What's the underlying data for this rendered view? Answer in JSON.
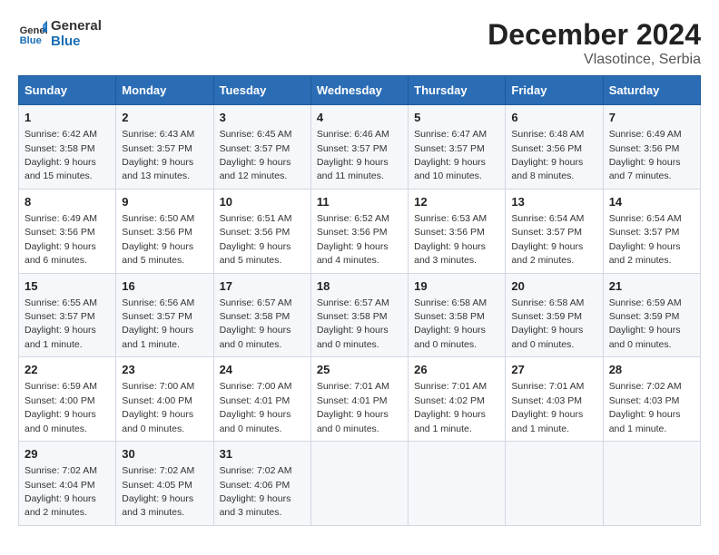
{
  "logo": {
    "text_general": "General",
    "text_blue": "Blue"
  },
  "title": "December 2024",
  "subtitle": "Vlasotince, Serbia",
  "days_of_week": [
    "Sunday",
    "Monday",
    "Tuesday",
    "Wednesday",
    "Thursday",
    "Friday",
    "Saturday"
  ],
  "weeks": [
    [
      {
        "day": "1",
        "sunrise": "6:42 AM",
        "sunset": "3:58 PM",
        "daylight": "9 hours and 15 minutes."
      },
      {
        "day": "2",
        "sunrise": "6:43 AM",
        "sunset": "3:57 PM",
        "daylight": "9 hours and 13 minutes."
      },
      {
        "day": "3",
        "sunrise": "6:45 AM",
        "sunset": "3:57 PM",
        "daylight": "9 hours and 12 minutes."
      },
      {
        "day": "4",
        "sunrise": "6:46 AM",
        "sunset": "3:57 PM",
        "daylight": "9 hours and 11 minutes."
      },
      {
        "day": "5",
        "sunrise": "6:47 AM",
        "sunset": "3:57 PM",
        "daylight": "9 hours and 10 minutes."
      },
      {
        "day": "6",
        "sunrise": "6:48 AM",
        "sunset": "3:56 PM",
        "daylight": "9 hours and 8 minutes."
      },
      {
        "day": "7",
        "sunrise": "6:49 AM",
        "sunset": "3:56 PM",
        "daylight": "9 hours and 7 minutes."
      }
    ],
    [
      {
        "day": "8",
        "sunrise": "6:49 AM",
        "sunset": "3:56 PM",
        "daylight": "9 hours and 6 minutes."
      },
      {
        "day": "9",
        "sunrise": "6:50 AM",
        "sunset": "3:56 PM",
        "daylight": "9 hours and 5 minutes."
      },
      {
        "day": "10",
        "sunrise": "6:51 AM",
        "sunset": "3:56 PM",
        "daylight": "9 hours and 5 minutes."
      },
      {
        "day": "11",
        "sunrise": "6:52 AM",
        "sunset": "3:56 PM",
        "daylight": "9 hours and 4 minutes."
      },
      {
        "day": "12",
        "sunrise": "6:53 AM",
        "sunset": "3:56 PM",
        "daylight": "9 hours and 3 minutes."
      },
      {
        "day": "13",
        "sunrise": "6:54 AM",
        "sunset": "3:57 PM",
        "daylight": "9 hours and 2 minutes."
      },
      {
        "day": "14",
        "sunrise": "6:54 AM",
        "sunset": "3:57 PM",
        "daylight": "9 hours and 2 minutes."
      }
    ],
    [
      {
        "day": "15",
        "sunrise": "6:55 AM",
        "sunset": "3:57 PM",
        "daylight": "9 hours and 1 minute."
      },
      {
        "day": "16",
        "sunrise": "6:56 AM",
        "sunset": "3:57 PM",
        "daylight": "9 hours and 1 minute."
      },
      {
        "day": "17",
        "sunrise": "6:57 AM",
        "sunset": "3:58 PM",
        "daylight": "9 hours and 0 minutes."
      },
      {
        "day": "18",
        "sunrise": "6:57 AM",
        "sunset": "3:58 PM",
        "daylight": "9 hours and 0 minutes."
      },
      {
        "day": "19",
        "sunrise": "6:58 AM",
        "sunset": "3:58 PM",
        "daylight": "9 hours and 0 minutes."
      },
      {
        "day": "20",
        "sunrise": "6:58 AM",
        "sunset": "3:59 PM",
        "daylight": "9 hours and 0 minutes."
      },
      {
        "day": "21",
        "sunrise": "6:59 AM",
        "sunset": "3:59 PM",
        "daylight": "9 hours and 0 minutes."
      }
    ],
    [
      {
        "day": "22",
        "sunrise": "6:59 AM",
        "sunset": "4:00 PM",
        "daylight": "9 hours and 0 minutes."
      },
      {
        "day": "23",
        "sunrise": "7:00 AM",
        "sunset": "4:00 PM",
        "daylight": "9 hours and 0 minutes."
      },
      {
        "day": "24",
        "sunrise": "7:00 AM",
        "sunset": "4:01 PM",
        "daylight": "9 hours and 0 minutes."
      },
      {
        "day": "25",
        "sunrise": "7:01 AM",
        "sunset": "4:01 PM",
        "daylight": "9 hours and 0 minutes."
      },
      {
        "day": "26",
        "sunrise": "7:01 AM",
        "sunset": "4:02 PM",
        "daylight": "9 hours and 1 minute."
      },
      {
        "day": "27",
        "sunrise": "7:01 AM",
        "sunset": "4:03 PM",
        "daylight": "9 hours and 1 minute."
      },
      {
        "day": "28",
        "sunrise": "7:02 AM",
        "sunset": "4:03 PM",
        "daylight": "9 hours and 1 minute."
      }
    ],
    [
      {
        "day": "29",
        "sunrise": "7:02 AM",
        "sunset": "4:04 PM",
        "daylight": "9 hours and 2 minutes."
      },
      {
        "day": "30",
        "sunrise": "7:02 AM",
        "sunset": "4:05 PM",
        "daylight": "9 hours and 3 minutes."
      },
      {
        "day": "31",
        "sunrise": "7:02 AM",
        "sunset": "4:06 PM",
        "daylight": "9 hours and 3 minutes."
      },
      null,
      null,
      null,
      null
    ]
  ]
}
